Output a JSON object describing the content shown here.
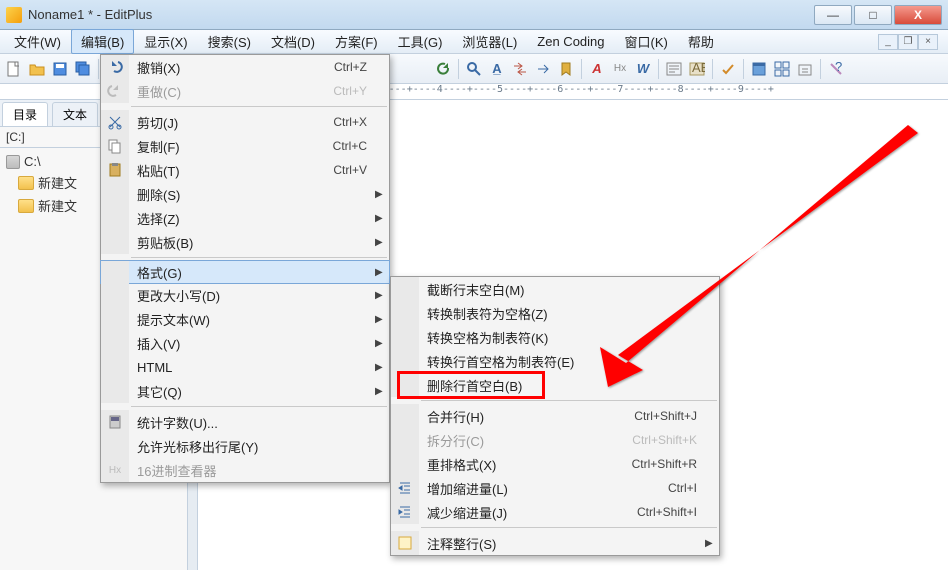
{
  "titlebar": {
    "title": "Noname1 * - EditPlus"
  },
  "win": {
    "min": "—",
    "max": "□",
    "close": "X"
  },
  "mdi": {
    "min": "_",
    "restore": "❐",
    "close": "×"
  },
  "menubar": {
    "file": "文件(W)",
    "edit": "编辑(B)",
    "view": "显示(X)",
    "search": "搜索(S)",
    "doc": "文档(D)",
    "project": "方案(F)",
    "tools": "工具(G)",
    "browser": "浏览器(L)",
    "zen": "Zen Coding",
    "window": "窗口(K)",
    "help": "帮助"
  },
  "editMenu": {
    "undo": {
      "label": "撤销(X)",
      "accel": "Ctrl+Z"
    },
    "redo": {
      "label": "重做(C)",
      "accel": "Ctrl+Y"
    },
    "cut": {
      "label": "剪切(J)",
      "accel": "Ctrl+X"
    },
    "copy": {
      "label": "复制(F)",
      "accel": "Ctrl+C"
    },
    "paste": {
      "label": "粘贴(T)",
      "accel": "Ctrl+V"
    },
    "delete": {
      "label": "删除(S)"
    },
    "select": {
      "label": "选择(Z)"
    },
    "clipboard": {
      "label": "剪贴板(B)"
    },
    "format": {
      "label": "格式(G)"
    },
    "changecase": {
      "label": "更改大小写(D)"
    },
    "extract": {
      "label": "提示文本(W)"
    },
    "insert": {
      "label": "插入(V)"
    },
    "html": {
      "label": "HTML"
    },
    "other": {
      "label": "其它(Q)"
    },
    "count": {
      "label": "统计字数(U)..."
    },
    "cursor": {
      "label": "允许光标移出行尾(Y)"
    },
    "hex": {
      "label": "16进制查看器"
    }
  },
  "formatSub": {
    "trimend": {
      "label": "截断行末空白(M)"
    },
    "tab2sp": {
      "label": "转换制表符为空格(Z)"
    },
    "sp2tab": {
      "label": "转换空格为制表符(K)"
    },
    "leadsp2tab": {
      "label": "转换行首空格为制表符(E)"
    },
    "trimlead": {
      "label": "删除行首空白(B)"
    },
    "joinline": {
      "label": "合并行(H)",
      "accel": "Ctrl+Shift+J"
    },
    "splitline": {
      "label": "拆分行(C)",
      "accel": "Ctrl+Shift+K"
    },
    "reformat": {
      "label": "重排格式(X)",
      "accel": "Ctrl+Shift+R"
    },
    "indent": {
      "label": "增加缩进量(L)",
      "accel": "Ctrl+I"
    },
    "unindent": {
      "label": "减少缩进量(J)",
      "accel": "Ctrl+Shift+I"
    },
    "comment": {
      "label": "注释整行(S)"
    }
  },
  "sidebar": {
    "tab1": "目录",
    "tab2": "文本",
    "drive": "[C:]",
    "root": "C:\\",
    "folder1": "新建文",
    "folder2": "新建文"
  },
  "ruler": "----+----1----+----2----+----3----+----4----+----5----+----6----+----7----+----8----+----9----+"
}
